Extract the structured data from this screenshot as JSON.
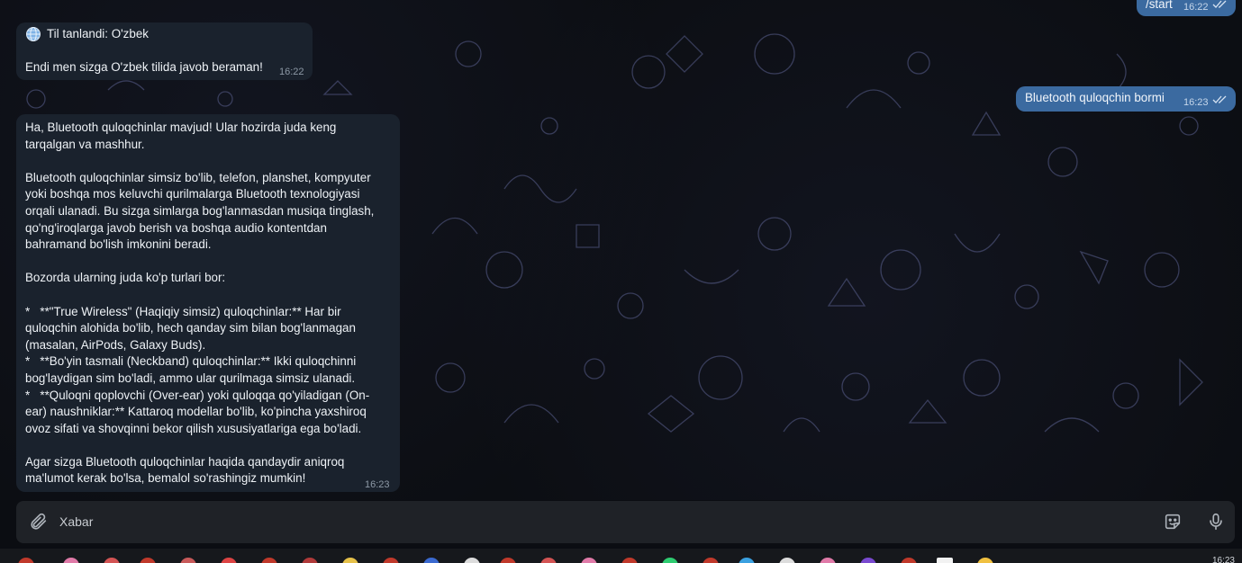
{
  "chat": {
    "outgoing": [
      {
        "text": "/start",
        "time": "16:22"
      },
      {
        "text": "Bluetooth quloqchin bormi",
        "time": "16:23"
      }
    ],
    "incoming": [
      {
        "line1_icon": "globe-icon",
        "line1": "Til tanlandi: O'zbek",
        "line2": "Endi men sizga O'zbek tilida javob beraman!",
        "time": "16:22"
      },
      {
        "text": "Ha, Bluetooth quloqchinlar mavjud! Ular hozirda juda keng\ntarqalgan va mashhur.\n\nBluetooth quloqchinlar simsiz bo'lib, telefon, planshet, kompyuter\nyoki boshqa mos keluvchi qurilmalarga Bluetooth texnologiyasi\norqali ulanadi. Bu sizga simlarga bog'lanmasdan musiqa tinglash,\nqo'ng'iroqlarga javob berish va boshqa audio kontentdan\nbahramand bo'lish imkonini beradi.\n\nBozorda ularning juda ko'p turlari bor:\n\n*   **\"True Wireless\" (Haqiqiy simsiz) quloqchinlar:** Har bir\nquloqchin alohida bo'lib, hech qanday sim bilan bog'lanmagan\n(masalan, AirPods, Galaxy Buds).\n*   **Bo'yin tasmali (Neckband) quloqchinlar:** Ikki quloqchinni\nbog'laydigan sim bo'ladi, ammo ular qurilmaga simsiz ulanadi.\n*   **Quloqni qoplovchi (Over-ear) yoki quloqqa qo'yiladigan (On-\near) naushniklar:** Kattaroq modellar bo'lib, ko'pincha yaxshiroq\novoz sifati va shovqinni bekor qilish xususiyatlariga ega bo'ladi.\n\nAgar sizga Bluetooth quloqchinlar haqida qandaydir aniqroq\nma'lumot kerak bo'lsa, bemalol so'rashingiz mumkin!",
        "time": "16:23"
      }
    ]
  },
  "composer": {
    "placeholder": "Xabar",
    "attach_icon": "paperclip-icon",
    "sticker_icon": "sticker-icon",
    "mic_icon": "microphone-icon"
  },
  "taskbar": {
    "clock": "16:23"
  },
  "colors": {
    "incoming_bubble": "#1a222d",
    "outgoing_bubble": "#3b6aa0",
    "background": "#0c0e13",
    "composer": "#1f2227"
  }
}
